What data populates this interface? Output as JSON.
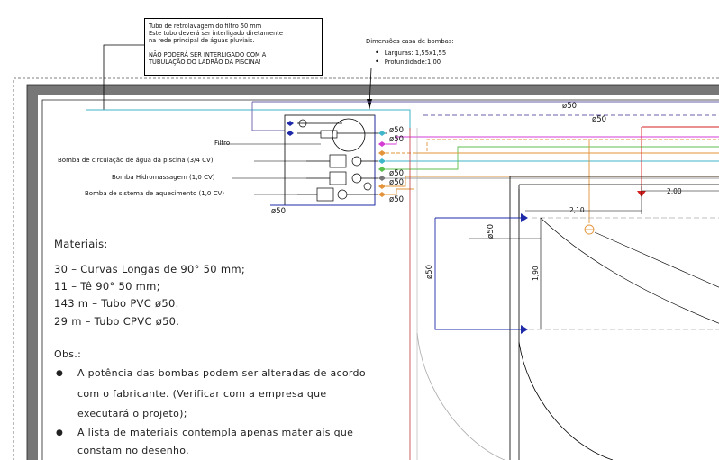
{
  "note_box": {
    "line1": "Tubo de retrolavagem do filtro 50 mm",
    "line2": "Este tubo deverá ser interligado diretamente",
    "line3": "na rede principal de águas pluviais.",
    "line4": "NÃO PODERÁ SER INTERLIGADO COM A",
    "line5": "TUBULAÇÃO DO LADRÃO DA PISCINA!"
  },
  "dimensions": {
    "title": "Dimensões casa de bombas:",
    "width": "Larguras: 1,55x1,55",
    "depth": "Profundidade:1,00"
  },
  "labels": {
    "filter": "Filtro",
    "pump_circulation": "Bomba de circulação de água da piscina (3/4 CV)",
    "pump_hydro": "Bomba Hidromassagem (1,0 CV)",
    "pump_heating": "Bomba de sistema de aquecimento (1,0 CV)"
  },
  "diameters": {
    "d1": "ø50",
    "d2": "ø50",
    "d3": "ø50",
    "d4": "ø50",
    "d5": "ø50",
    "d6": "ø50",
    "d7": "ø50",
    "d8": "ø50",
    "d9": "ø50",
    "d10": "ø50",
    "d11": "ø50"
  },
  "dimension_marks": {
    "dim_200": "2,00",
    "dim_210": "2,10",
    "dim_190": "1,90"
  },
  "materials": {
    "title": "Materiais:",
    "items": [
      "30 – Curvas Longas de 90° 50 mm;",
      "11 – Tê 90° 50 mm;",
      "143 m – Tubo PVC ø50.",
      "29 m – Tubo CPVC ø50."
    ]
  },
  "observations": {
    "title": "Obs.:",
    "bullet_1_line_1": "A potência das bombas podem ser alteradas de acordo",
    "bullet_1_line_2": "com o fabricante. (Verificar com a empresa que",
    "bullet_1_line_3": "executará o projeto);",
    "bullet_2_line_1": "A lista de materiais contempla apenas materiais que",
    "bullet_2_line_2": "constam no desenho."
  },
  "colors": {
    "wall": "#7a7a7a",
    "cyan": "#3fb6c9",
    "blue": "#1e2aa8",
    "red": "#d62020",
    "orange": "#e3943a",
    "green": "#5cbf4c",
    "magenta": "#d43bd4",
    "purple": "#6a5fa8"
  }
}
